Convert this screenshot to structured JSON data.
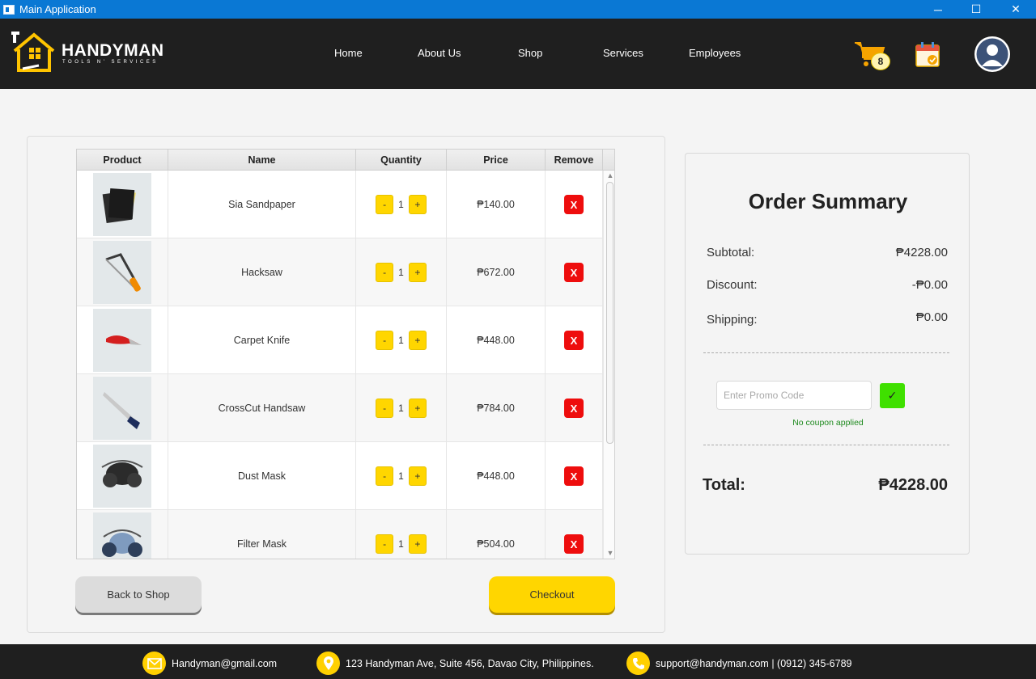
{
  "window": {
    "title": "Main Application",
    "minimize": "─",
    "maximize": "☐",
    "close": "✕"
  },
  "brand": {
    "name": "HANDYMAN",
    "tagline": "TOOLS N' SERVICES"
  },
  "nav": {
    "links": [
      "Home",
      "About Us",
      "Shop",
      "Services",
      "Employees"
    ],
    "cart_count": "8"
  },
  "cart": {
    "columns": [
      "Product",
      "Name",
      "Quantity",
      "Price",
      "Remove"
    ],
    "items": [
      {
        "name": "Sia Sandpaper",
        "qty": "1",
        "price": "₱140.00",
        "icon": "sandpaper-image"
      },
      {
        "name": "Hacksaw",
        "qty": "1",
        "price": "₱672.00",
        "icon": "hacksaw-image"
      },
      {
        "name": "Carpet Knife",
        "qty": "1",
        "price": "₱448.00",
        "icon": "carpet-knife-image"
      },
      {
        "name": "CrossCut Handsaw",
        "qty": "1",
        "price": "₱784.00",
        "icon": "handsaw-image"
      },
      {
        "name": "Dust Mask",
        "qty": "1",
        "price": "₱448.00",
        "icon": "dust-mask-image"
      },
      {
        "name": "Filter Mask",
        "qty": "1",
        "price": "₱504.00",
        "icon": "filter-mask-image"
      }
    ],
    "minus": "-",
    "plus": "+",
    "remove": "X",
    "back_label": "Back to Shop",
    "checkout_label": "Checkout"
  },
  "summary": {
    "title": "Order Summary",
    "subtotal_label": "Subtotal:",
    "subtotal": "₱4228.00",
    "discount_label": "Discount:",
    "discount": "-₱0.00",
    "shipping_label": "Shipping:",
    "shipping": "₱0.00",
    "promo_placeholder": "Enter Promo Code",
    "apply": "✓",
    "coupon_status": "No coupon applied",
    "total_label": "Total:",
    "total": "₱4228.00"
  },
  "footer": {
    "email": "Handyman@gmail.com",
    "address": "123 Handyman Ave, Suite 456, Davao City, Philippines.",
    "support": "support@handyman.com | (0912) 345-6789"
  },
  "colors": {
    "accent": "#ffd600",
    "navbar": "#1f1f1f",
    "titlebar": "#0a78d4",
    "remove": "#ee0d0d",
    "apply": "#3fe000"
  }
}
